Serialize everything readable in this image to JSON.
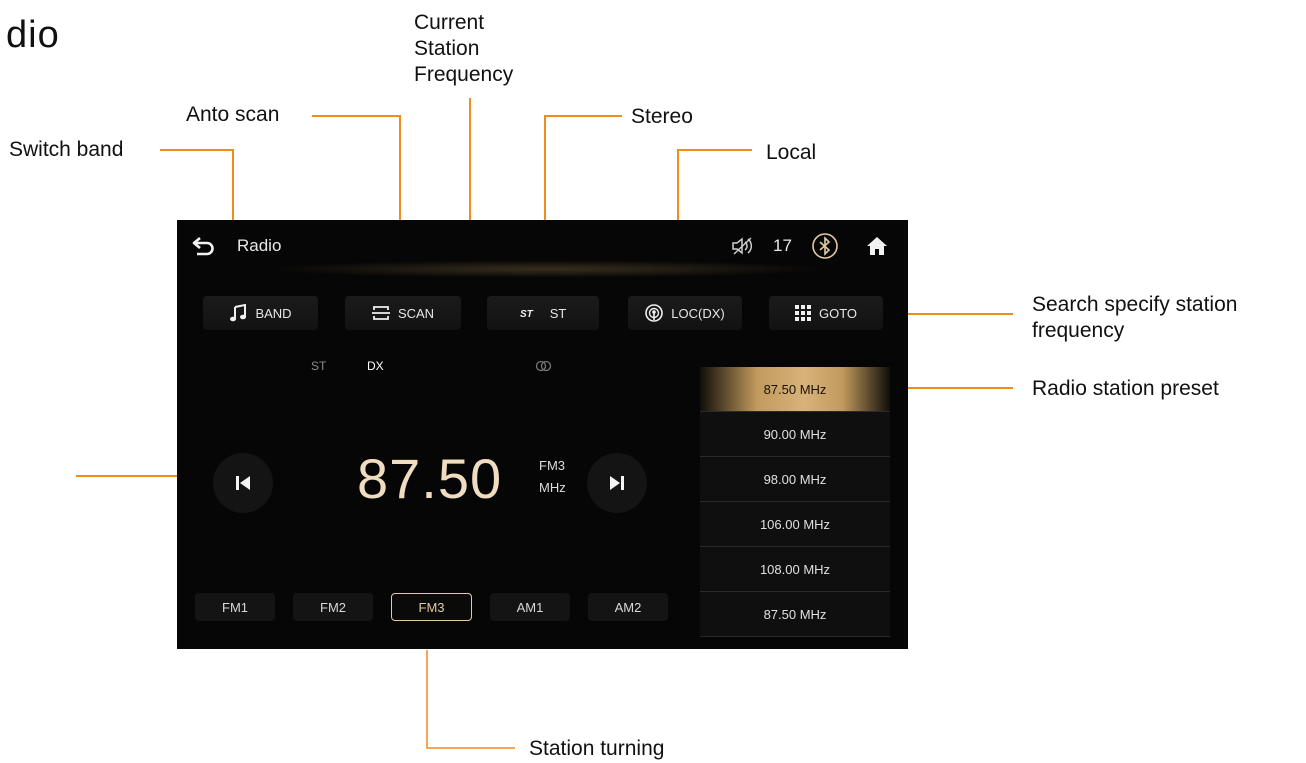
{
  "page": {
    "title": "dio"
  },
  "callouts": {
    "current_station_frequency": [
      "Current",
      "Station",
      "Frequency"
    ],
    "auto_scan": "Anto scan",
    "stereo": "Stereo",
    "switch_band": "Switch band",
    "local": "Local",
    "search_station": [
      "Search specify station",
      "frequency"
    ],
    "radio_preset": "Radio station preset",
    "station_turning": "Station turning"
  },
  "screen": {
    "title": "Radio",
    "volume": "17",
    "controls": [
      {
        "label": "BAND",
        "icon": "music-note-icon"
      },
      {
        "label": "SCAN",
        "icon": "scan-icon"
      },
      {
        "label": "ST",
        "icon": "stereo-icon"
      },
      {
        "label": "LOC(DX)",
        "icon": "local-icon"
      },
      {
        "label": "GOTO",
        "icon": "grid-icon"
      }
    ],
    "indicators": {
      "st": "ST",
      "dx": "DX"
    },
    "frequency": "87.50",
    "band": "FM3",
    "unit": "MHz",
    "band_tabs": [
      "FM1",
      "FM2",
      "FM3",
      "AM1",
      "AM2"
    ],
    "active_band_tab": "FM3",
    "presets": [
      "87.50 MHz",
      "90.00 MHz",
      "98.00 MHz",
      "106.00 MHz",
      "108.00 MHz",
      "87.50 MHz"
    ],
    "selected_preset_index": 0,
    "colors": {
      "accent": "#e3cba3",
      "callout_line": "#f08c1e",
      "preset_highlight": "#d7b27a"
    }
  }
}
